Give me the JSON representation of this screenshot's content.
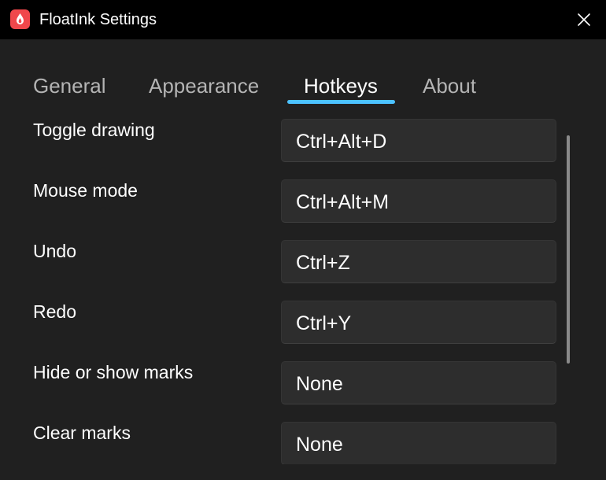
{
  "window": {
    "title": "FloatInk Settings"
  },
  "tabs": [
    {
      "label": "General",
      "active": false
    },
    {
      "label": "Appearance",
      "active": false
    },
    {
      "label": "Hotkeys",
      "active": true
    },
    {
      "label": "About",
      "active": false
    }
  ],
  "hotkeys": [
    {
      "label": "Toggle drawing",
      "value": "Ctrl+Alt+D"
    },
    {
      "label": "Mouse mode",
      "value": "Ctrl+Alt+M"
    },
    {
      "label": "Undo",
      "value": "Ctrl+Z"
    },
    {
      "label": "Redo",
      "value": "Ctrl+Y"
    },
    {
      "label": "Hide or show marks",
      "value": "None"
    },
    {
      "label": "Clear marks",
      "value": "None"
    }
  ],
  "colors": {
    "accent": "#4cc2ff",
    "app_icon": "#f0474b",
    "background": "#202020",
    "titlebar": "#000000",
    "field": "#2d2d2d"
  },
  "icons": {
    "app": "flame-drop-icon",
    "close": "close-icon"
  }
}
